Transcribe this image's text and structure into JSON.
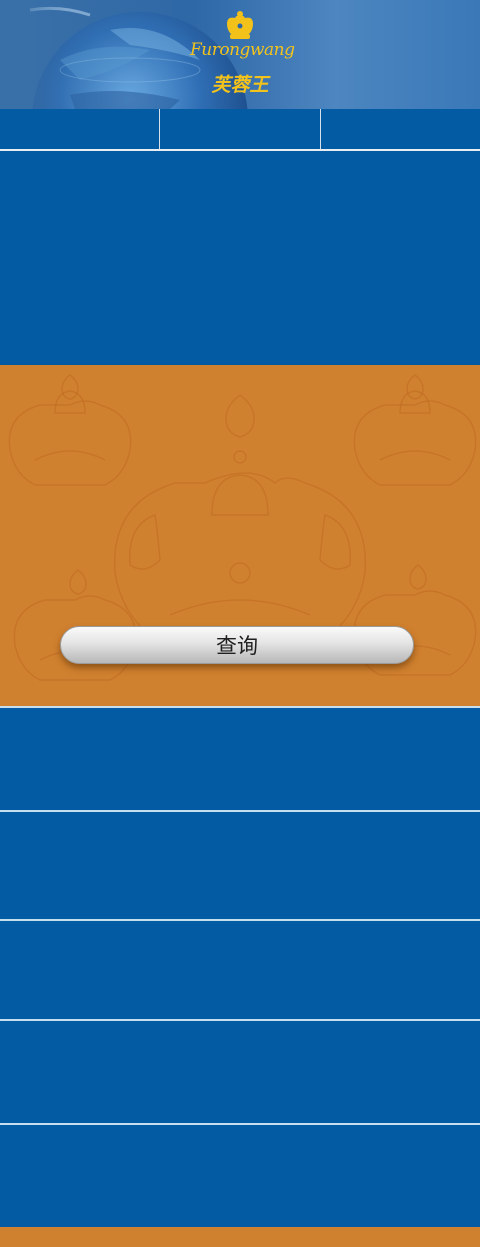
{
  "header": {
    "brand_latin": "Furongwang",
    "brand_chinese": "芙蓉王",
    "crown_color": "#f2c21b"
  },
  "navbar": {
    "tabs": [
      "",
      "",
      ""
    ]
  },
  "query_panel": {
    "background": "#d0812f",
    "query_button_label": "查询"
  },
  "result_rows": [
    "",
    "",
    "",
    "",
    ""
  ],
  "colors": {
    "primary_blue": "#025ba3",
    "accent_orange": "#d0812f",
    "divider": "#c6dfee"
  }
}
